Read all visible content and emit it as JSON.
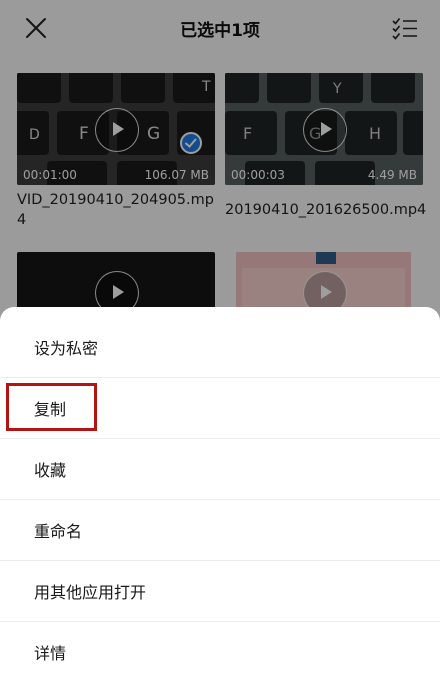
{
  "header": {
    "title": "已选中1项",
    "close_icon": "close-icon",
    "select_all_icon": "checklist-icon"
  },
  "videos": [
    {
      "duration": "00:01:00",
      "size": "106.07 MB",
      "name": "VID_20190410_204905.mp4",
      "selected": true
    },
    {
      "duration": "00:00:03",
      "size": "4.49 MB",
      "name": "20190410_201626500.mp4",
      "selected": false
    },
    {
      "duration": "",
      "size": "",
      "name": "",
      "selected": false
    },
    {
      "duration": "",
      "size": "",
      "name": "",
      "selected": false
    }
  ],
  "menu": {
    "items": [
      {
        "label": "设为私密"
      },
      {
        "label": "复制"
      },
      {
        "label": "收藏"
      },
      {
        "label": "重命名"
      },
      {
        "label": "用其他应用打开"
      },
      {
        "label": "详情"
      }
    ],
    "highlight_color": "#b21414"
  },
  "colors": {
    "accent": "#1e7be6"
  }
}
